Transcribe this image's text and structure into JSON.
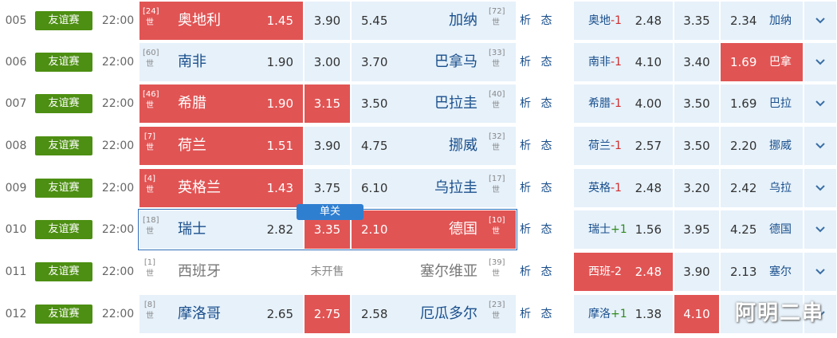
{
  "rows": [
    {
      "no": "005",
      "league": "友谊赛",
      "time": "22:00",
      "home_rank": "[24]",
      "home_rank_sub": "世",
      "home": "奥地利",
      "home_odd": "1.45",
      "draw_odd": "3.90",
      "away_odd": "5.45",
      "away": "加纳",
      "away_rank": "[72]",
      "away_rank_sub": "世",
      "analysis": "析 态",
      "h_home": "奥地",
      "h_hc": "-1",
      "h_home_odd": "2.48",
      "h_draw_odd": "3.35",
      "h_away_odd": "2.34",
      "h_away": "加纳"
    },
    {
      "no": "006",
      "league": "友谊赛",
      "time": "22:00",
      "home_rank": "[60]",
      "home_rank_sub": "世",
      "home": "南非",
      "home_odd": "1.90",
      "draw_odd": "3.00",
      "away_odd": "3.70",
      "away": "巴拿马",
      "away_rank": "[33]",
      "away_rank_sub": "世",
      "analysis": "析 态",
      "h_home": "南非",
      "h_hc": "-1",
      "h_home_odd": "4.10",
      "h_draw_odd": "3.40",
      "h_away_odd": "1.69",
      "h_away": "巴拿"
    },
    {
      "no": "007",
      "league": "友谊赛",
      "time": "22:00",
      "home_rank": "[46]",
      "home_rank_sub": "世",
      "home": "希腊",
      "home_odd": "1.90",
      "draw_odd": "3.15",
      "away_odd": "3.50",
      "away": "巴拉圭",
      "away_rank": "[40]",
      "away_rank_sub": "世",
      "analysis": "析 态",
      "h_home": "希腊",
      "h_hc": "-1",
      "h_home_odd": "4.00",
      "h_draw_odd": "3.50",
      "h_away_odd": "1.69",
      "h_away": "巴拉"
    },
    {
      "no": "008",
      "league": "友谊赛",
      "time": "22:00",
      "home_rank": "[7]",
      "home_rank_sub": "世",
      "home": "荷兰",
      "home_odd": "1.51",
      "draw_odd": "3.90",
      "away_odd": "4.75",
      "away": "挪威",
      "away_rank": "[32]",
      "away_rank_sub": "世",
      "analysis": "析 态",
      "h_home": "荷兰",
      "h_hc": "-1",
      "h_home_odd": "2.57",
      "h_draw_odd": "3.50",
      "h_away_odd": "2.20",
      "h_away": "挪威"
    },
    {
      "no": "009",
      "league": "友谊赛",
      "time": "22:00",
      "home_rank": "[4]",
      "home_rank_sub": "世",
      "home": "英格兰",
      "home_odd": "1.43",
      "draw_odd": "3.75",
      "away_odd": "6.10",
      "away": "乌拉圭",
      "away_rank": "[17]",
      "away_rank_sub": "世",
      "analysis": "析 态",
      "h_home": "英格",
      "h_hc": "-1",
      "h_home_odd": "2.48",
      "h_draw_odd": "3.20",
      "h_away_odd": "2.42",
      "h_away": "乌拉"
    },
    {
      "no": "010",
      "league": "友谊赛",
      "time": "22:00",
      "home_rank": "[18]",
      "home_rank_sub": "世",
      "home": "瑞士",
      "home_odd": "2.82",
      "draw_odd": "3.35",
      "away_odd": "2.10",
      "away": "德国",
      "away_rank": "[10]",
      "away_rank_sub": "世",
      "analysis": "析 态",
      "h_home": "瑞士",
      "h_hc": "+1",
      "h_home_odd": "1.56",
      "h_draw_odd": "3.95",
      "h_away_odd": "4.25",
      "h_away": "德国"
    },
    {
      "no": "011",
      "league": "友谊赛",
      "time": "22:00",
      "home_rank": "[1]",
      "home_rank_sub": "世",
      "home": "西班牙",
      "home_odd": "",
      "draw_odd": "未开售",
      "away_odd": "",
      "away": "塞尔维亚",
      "away_rank": "[39]",
      "away_rank_sub": "世",
      "analysis": "析 态",
      "h_home": "西班",
      "h_hc": "-2",
      "h_home_odd": "2.48",
      "h_draw_odd": "3.90",
      "h_away_odd": "2.13",
      "h_away": "塞尔"
    },
    {
      "no": "012",
      "league": "友谊赛",
      "time": "22:00",
      "home_rank": "[8]",
      "home_rank_sub": "世",
      "home": "摩洛哥",
      "home_odd": "2.65",
      "draw_odd": "2.75",
      "away_odd": "2.58",
      "away": "厄瓜多尔",
      "away_rank": "[23]",
      "away_rank_sub": "世",
      "analysis": "析 态",
      "h_home": "摩洛",
      "h_hc": "+1",
      "h_home_odd": "1.38",
      "h_draw_odd": "4.10",
      "h_away_odd": "",
      "h_away": ""
    }
  ],
  "single_tag": "单关",
  "watermark": "阿明二串",
  "colors": {
    "selected": "#e15454",
    "cell": "#e6f1fa",
    "league_badge": "#4d8f12",
    "link": "#1a4f8c",
    "single_tag": "#2f7fd1"
  },
  "icons": {
    "expand": "chevron-down-icon"
  }
}
